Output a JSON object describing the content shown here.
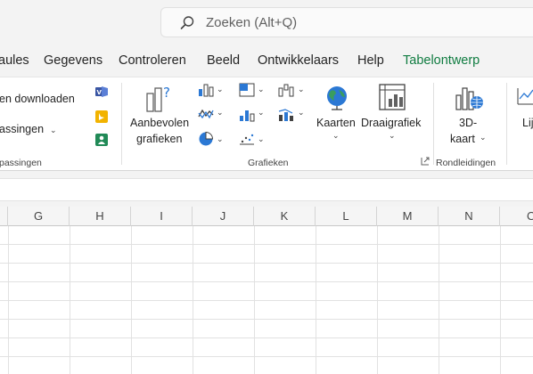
{
  "search": {
    "placeholder": "Zoeken (Alt+Q)"
  },
  "menu": {
    "items": [
      "aules",
      "Gegevens",
      "Controleren",
      "Beeld",
      "Ontwikkelaars",
      "Help",
      "Tabelontwerp"
    ]
  },
  "ribbon": {
    "addins": {
      "download_label": "en downloaden",
      "manage_label": "assingen",
      "group_label": "passingen"
    },
    "charts": {
      "recommended_line1": "Aanbevolen",
      "recommended_line2": "grafieken",
      "maps_label": "Kaarten",
      "pivot_label": "Draaigrafiek",
      "group_label": "Grafieken"
    },
    "tours": {
      "map3d_line1": "3D-",
      "map3d_line2": "kaart",
      "group_label": "Rondleidingen"
    },
    "sparklines": {
      "line_label": "Lijn"
    }
  },
  "columns": [
    "G",
    "H",
    "I",
    "J",
    "K",
    "L",
    "M",
    "N",
    "O"
  ],
  "colors": {
    "accent_green": "#107c41",
    "chart_blue": "#2b78d4",
    "ribbon_bg": "#ffffff"
  }
}
